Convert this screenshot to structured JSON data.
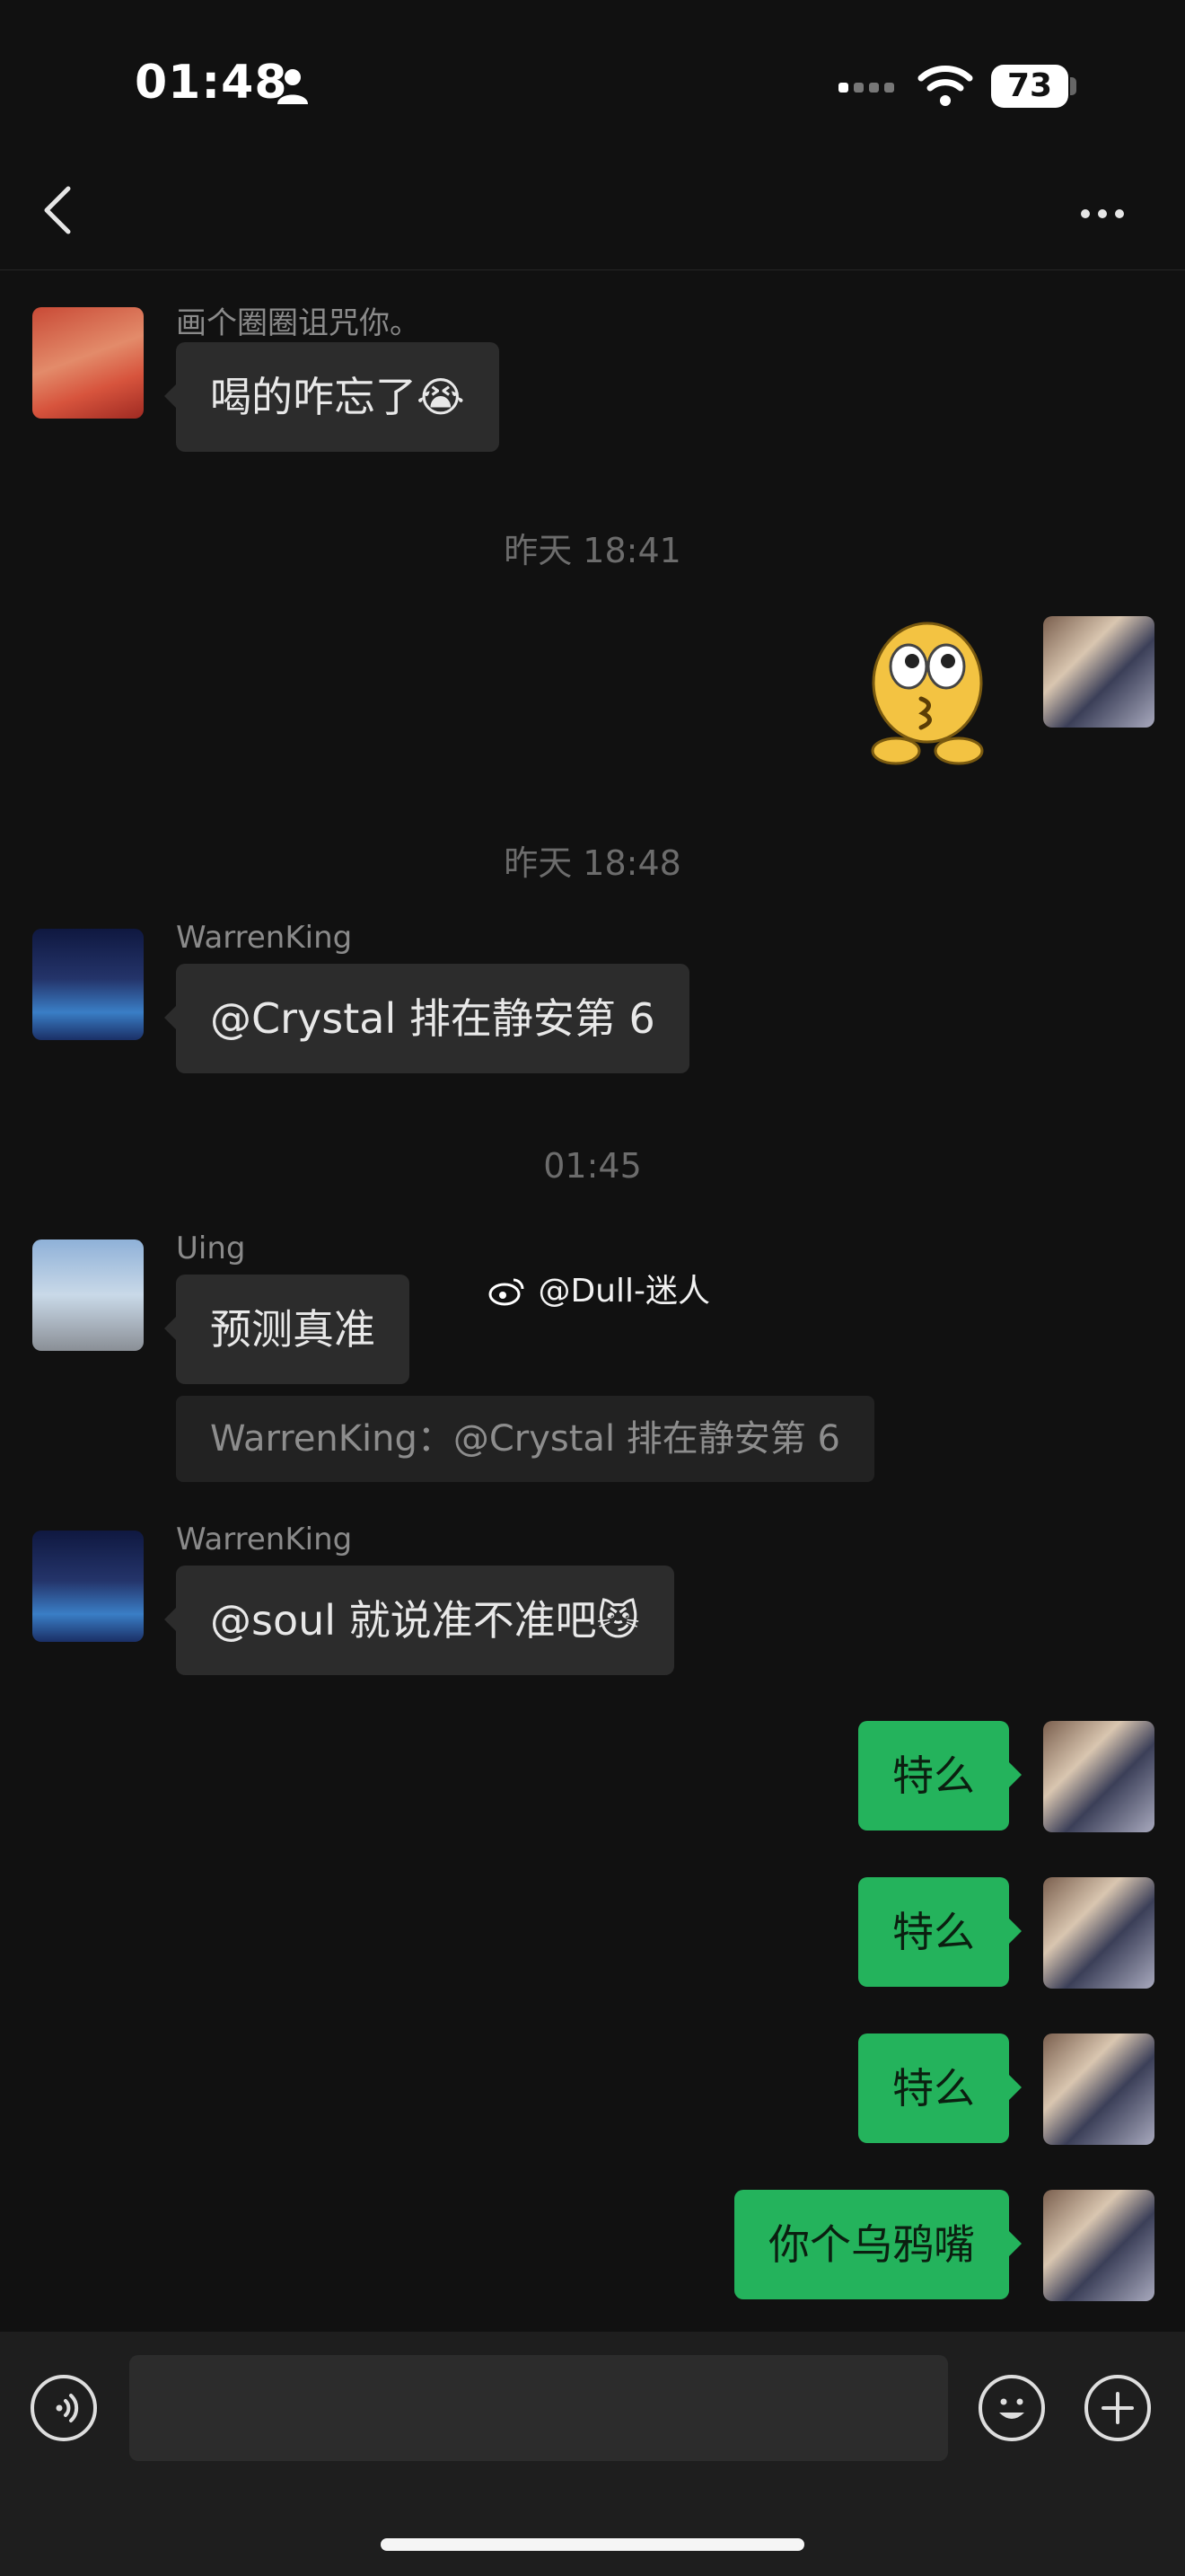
{
  "status_bar": {
    "time": "01:48",
    "battery": "73"
  },
  "nav": {
    "back_icon": "chevron-left-icon",
    "more_icon": "more-dots-icon"
  },
  "messages": [
    {
      "sender": "画个圈圈诅咒你。",
      "text": "喝的咋忘了😭"
    },
    {
      "timestamp": "昨天 18:41"
    },
    {
      "sticker": "kiss-emoji-sticker"
    },
    {
      "timestamp": "昨天 18:48"
    },
    {
      "sender": "WarrenKing",
      "text": "@Crystal 排在静安第 6"
    },
    {
      "timestamp": "01:45"
    },
    {
      "sender": "Uing",
      "text": "预测真准",
      "quote": "WarrenKing：@Crystal 排在静安第 6"
    },
    {
      "sender": "WarrenKing",
      "text": "@soul 就说准不准吧😼"
    },
    {
      "text": "特么"
    },
    {
      "text": "特么"
    },
    {
      "text": "特么"
    },
    {
      "text": "你个乌鸦嘴"
    }
  ],
  "watermark": "@Dull-迷人",
  "colors": {
    "background": "#111111",
    "incoming_bubble": "#2c2c2c",
    "outgoing_bubble": "#24b35c"
  }
}
